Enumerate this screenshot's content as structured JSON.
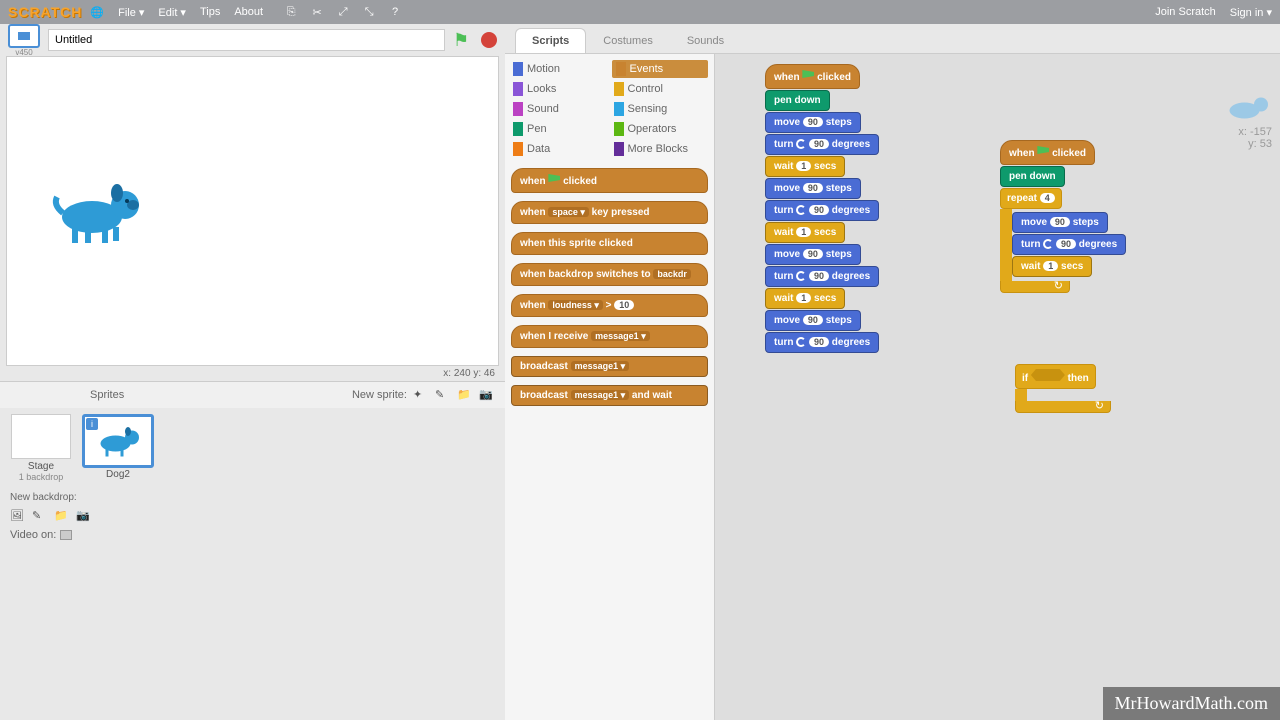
{
  "menu": {
    "file": "File ▾",
    "edit": "Edit ▾",
    "tips": "Tips",
    "about": "About",
    "join": "Join Scratch",
    "signin": "Sign in ▾"
  },
  "project": {
    "title": "Untitled",
    "version": "v450"
  },
  "stage": {
    "coords": "x: 240   y: 46"
  },
  "sprites": {
    "header": "Sprites",
    "new": "New sprite:",
    "stage_label": "Stage",
    "stage_sub": "1 backdrop",
    "sprite1": "Dog2",
    "new_backdrop": "New backdrop:",
    "video": "Video on:"
  },
  "tabs": {
    "scripts": "Scripts",
    "costumes": "Costumes",
    "sounds": "Sounds"
  },
  "categories": [
    {
      "name": "Motion",
      "color": "#4a6cd4"
    },
    {
      "name": "Events",
      "color": "#c88330",
      "active": true
    },
    {
      "name": "Looks",
      "color": "#8a55d7"
    },
    {
      "name": "Control",
      "color": "#e1a91a"
    },
    {
      "name": "Sound",
      "color": "#bb42c3"
    },
    {
      "name": "Sensing",
      "color": "#2ca5e2"
    },
    {
      "name": "Pen",
      "color": "#0e9a6c"
    },
    {
      "name": "Operators",
      "color": "#5cb712"
    },
    {
      "name": "Data",
      "color": "#ee7d16"
    },
    {
      "name": "More Blocks",
      "color": "#632d99"
    }
  ],
  "palette": {
    "when_clicked": "when      clicked",
    "when_key": "when  space ▾  key pressed",
    "when_sprite": "when this sprite clicked",
    "when_backdrop": "when backdrop switches to  backdr",
    "when_loudness": "when  loudness ▾  >  10",
    "when_receive": "when I receive  message1 ▾",
    "broadcast": "broadcast  message1 ▾",
    "broadcast_wait": "broadcast  message1 ▾  and wait"
  },
  "script1": [
    {
      "type": "hat",
      "text": "when  🏳  clicked"
    },
    {
      "type": "pen",
      "text": "pen down"
    },
    {
      "type": "motion",
      "text": "move 90 steps"
    },
    {
      "type": "motion",
      "text": "turn ↻ 90 degrees"
    },
    {
      "type": "control",
      "text": "wait 1 secs"
    },
    {
      "type": "motion",
      "text": "move 90 steps"
    },
    {
      "type": "motion",
      "text": "turn ↻ 90 degrees"
    },
    {
      "type": "control",
      "text": "wait 1 secs"
    },
    {
      "type": "motion",
      "text": "move 90 steps"
    },
    {
      "type": "motion",
      "text": "turn ↻ 90 degrees"
    },
    {
      "type": "control",
      "text": "wait 1 secs"
    },
    {
      "type": "motion",
      "text": "move 90 steps"
    },
    {
      "type": "motion",
      "text": "turn ↻ 90 degrees"
    }
  ],
  "script2": {
    "hat": "when  🏳  clicked",
    "pen": "pen down",
    "repeat": "repeat 4",
    "body": [
      {
        "type": "motion",
        "text": "move 90 steps"
      },
      {
        "type": "motion",
        "text": "turn ↻ 90 degrees"
      },
      {
        "type": "control",
        "text": "wait 1 secs"
      }
    ]
  },
  "if_block": "if          then",
  "sprite_info": {
    "x": "x: -157",
    "y": "y: 53"
  },
  "watermark": "MrHowardMath.com"
}
